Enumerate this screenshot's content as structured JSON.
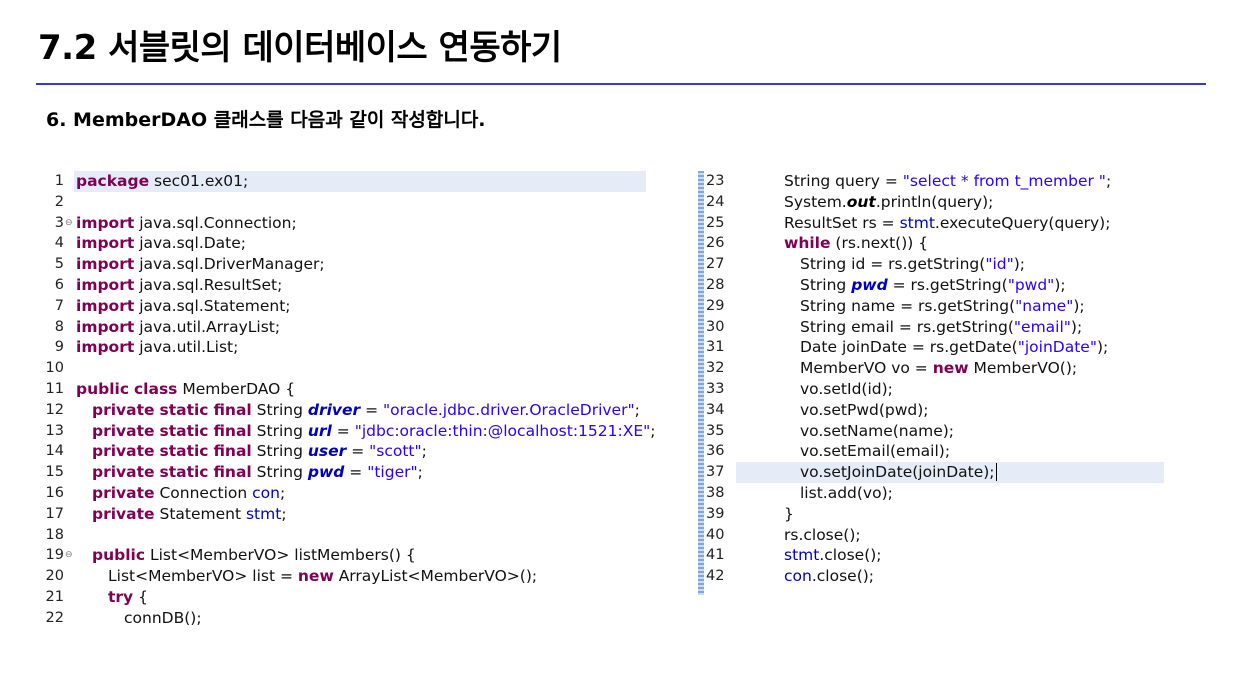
{
  "slide": {
    "title": "7.2 서블릿의 데이터베이스 연동하기",
    "subtitle": "6. MemberDAO 클래스를 다음과 같이 작성합니다."
  },
  "left_code": [
    {
      "n": "1",
      "t": "package sec01.ex01;"
    },
    {
      "n": "2",
      "t": ""
    },
    {
      "n": "3",
      "t": "import java.sql.Connection;"
    },
    {
      "n": "4",
      "t": "import java.sql.Date;"
    },
    {
      "n": "5",
      "t": "import java.sql.DriverManager;"
    },
    {
      "n": "6",
      "t": "import java.sql.ResultSet;"
    },
    {
      "n": "7",
      "t": "import java.sql.Statement;"
    },
    {
      "n": "8",
      "t": "import java.util.ArrayList;"
    },
    {
      "n": "9",
      "t": "import java.util.List;"
    },
    {
      "n": "10",
      "t": ""
    },
    {
      "n": "11",
      "t": "public class MemberDAO {"
    },
    {
      "n": "12",
      "t": "private static final String driver = \"oracle.jdbc.driver.OracleDriver\";"
    },
    {
      "n": "13",
      "t": "private static final String url = \"jdbc:oracle:thin:@localhost:1521:XE\";"
    },
    {
      "n": "14",
      "t": "private static final String user = \"scott\";"
    },
    {
      "n": "15",
      "t": "private static final String pwd = \"tiger\";"
    },
    {
      "n": "16",
      "t": "private Connection con;"
    },
    {
      "n": "17",
      "t": "private Statement stmt;"
    },
    {
      "n": "18",
      "t": ""
    },
    {
      "n": "19",
      "t": "public List<MemberVO> listMembers() {"
    },
    {
      "n": "20",
      "t": "List<MemberVO> list = new ArrayList<MemberVO>();"
    },
    {
      "n": "21",
      "t": "try {"
    },
    {
      "n": "22",
      "t": "connDB();"
    }
  ],
  "right_code": [
    {
      "n": "23",
      "t": "String query = \"select * from t_member \";"
    },
    {
      "n": "24",
      "t": "System.out.println(query);"
    },
    {
      "n": "25",
      "t": "ResultSet rs = stmt.executeQuery(query);"
    },
    {
      "n": "26",
      "t": "while (rs.next()) {"
    },
    {
      "n": "27",
      "t": "String id = rs.getString(\"id\");"
    },
    {
      "n": "28",
      "t": "String pwd = rs.getString(\"pwd\");"
    },
    {
      "n": "29",
      "t": "String name = rs.getString(\"name\");"
    },
    {
      "n": "30",
      "t": "String email = rs.getString(\"email\");"
    },
    {
      "n": "31",
      "t": "Date joinDate = rs.getDate(\"joinDate\");"
    },
    {
      "n": "32",
      "t": "MemberVO vo = new MemberVO();"
    },
    {
      "n": "33",
      "t": "vo.setId(id);"
    },
    {
      "n": "34",
      "t": "vo.setPwd(pwd);"
    },
    {
      "n": "35",
      "t": "vo.setName(name);"
    },
    {
      "n": "36",
      "t": "vo.setEmail(email);"
    },
    {
      "n": "37",
      "t": "vo.setJoinDate(joinDate);"
    },
    {
      "n": "38",
      "t": "list.add(vo);"
    },
    {
      "n": "39",
      "t": "}"
    },
    {
      "n": "40",
      "t": "rs.close();"
    },
    {
      "n": "41",
      "t": "stmt.close();"
    },
    {
      "n": "42",
      "t": "con.close();"
    }
  ]
}
